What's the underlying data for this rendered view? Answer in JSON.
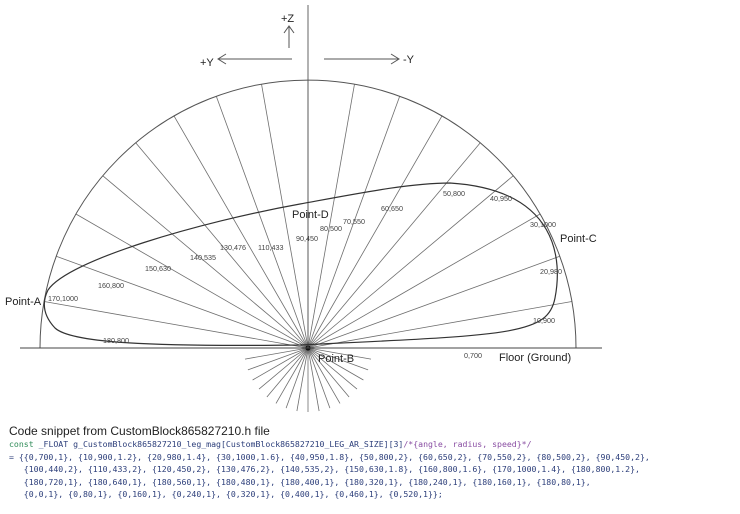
{
  "axes": {
    "z_label": "+Z",
    "y_plus_label": "+Y",
    "y_minus_label": "-Y",
    "floor_label": "Floor (Ground)"
  },
  "points": {
    "a": "Point-A",
    "b": "Point-B",
    "c": "Point-C",
    "d": "Point-D"
  },
  "ray_labels": [
    "0,700",
    "10,900",
    "20,980",
    "30,1000",
    "40,950",
    "50,800",
    "60,650",
    "70,550",
    "80,500",
    "90,450",
    "100,440",
    "110,433",
    "120,450",
    "130,476",
    "140,535",
    "150,630",
    "160,800",
    "170,1000",
    "180,800"
  ],
  "code_snippet": {
    "title": "Code snippet from CustomBlock865827210.h file",
    "keyword": "const",
    "declaration": " _FLOAT g_CustomBlock865827210_leg_mag[CustomBlock865827210_LEG_AR_SIZE][3]",
    "comment": "/*{angle, radius, speed}*/",
    "lines": [
      "= {{0,700,1}, {10,900,1.2}, {20,980,1.4}, {30,1000,1.6}, {40,950,1.8}, {50,800,2}, {60,650,2}, {70,550,2}, {80,500,2}, {90,450,2},",
      "   {100,440,2}, {110,433,2}, {120,450,2}, {130,476,2}, {140,535,2}, {150,630,1.8}, {160,800,1.6}, {170,1000,1.4}, {180,800,1.2},",
      "   {180,720,1}, {180,640,1}, {180,560,1}, {180,480,1}, {180,400,1}, {180,320,1}, {180,240,1}, {180,160,1}, {180,80,1},",
      "   {0,0,1}, {0,80,1}, {0,160,1}, {0,240,1}, {0,320,1}, {0,400,1}, {0,460,1}, {0,520,1}};"
    ]
  }
}
